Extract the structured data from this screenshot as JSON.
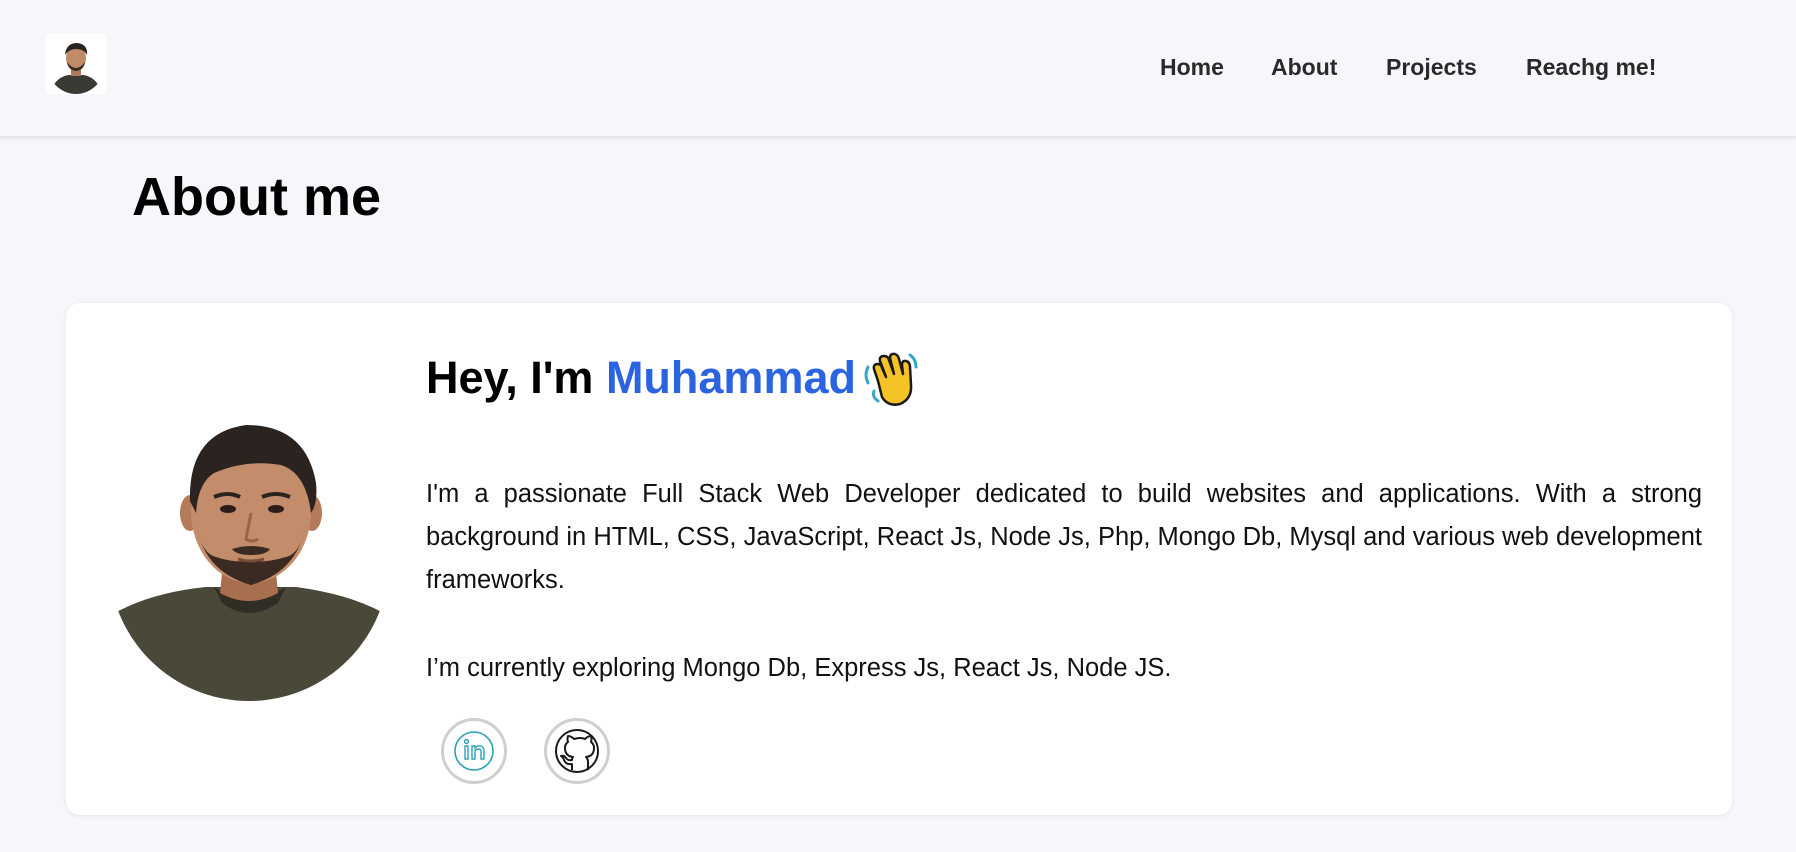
{
  "header": {
    "logo_alt": "Profile photo",
    "nav": [
      {
        "label": "Home"
      },
      {
        "label": "About"
      },
      {
        "label": "Projects"
      },
      {
        "label": "Reachg me!"
      }
    ]
  },
  "main": {
    "title": "About me",
    "card": {
      "greeting_prefix": "Hey, I'm ",
      "greeting_name": "Muhammad",
      "wave_icon": "waving-hand-icon",
      "bio": "I'm a passionate Full Stack Web Developer dedicated to build websites and applications. With a strong background in HTML, CSS, JavaScript, React Js, Node Js, Php, Mongo Db, Mysql and various web development frameworks.",
      "exploring": "I’m currently exploring Mongo Db, Express Js, React Js, Node JS.",
      "socials": [
        {
          "icon": "linkedin-icon"
        },
        {
          "icon": "github-icon"
        }
      ]
    }
  },
  "colors": {
    "accent": "#2b63e0",
    "background": "#f6f7fb",
    "card": "#ffffff"
  }
}
